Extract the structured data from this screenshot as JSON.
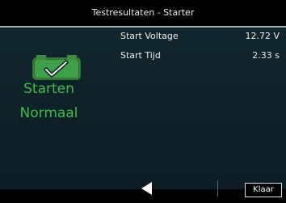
{
  "window": {
    "title": "Testresultaten - Starter"
  },
  "results": [
    {
      "label": "Start Voltage",
      "value": "12.72 V"
    },
    {
      "label": "Start Tijd",
      "value": "2.33 s"
    }
  ],
  "status": {
    "line1": "Starten",
    "line2": "Normaal",
    "icon": "battery-check-icon",
    "color": "#3bbf4a"
  },
  "footer": {
    "back_icon": "left-arrow-icon",
    "done_label": "Klaar"
  }
}
